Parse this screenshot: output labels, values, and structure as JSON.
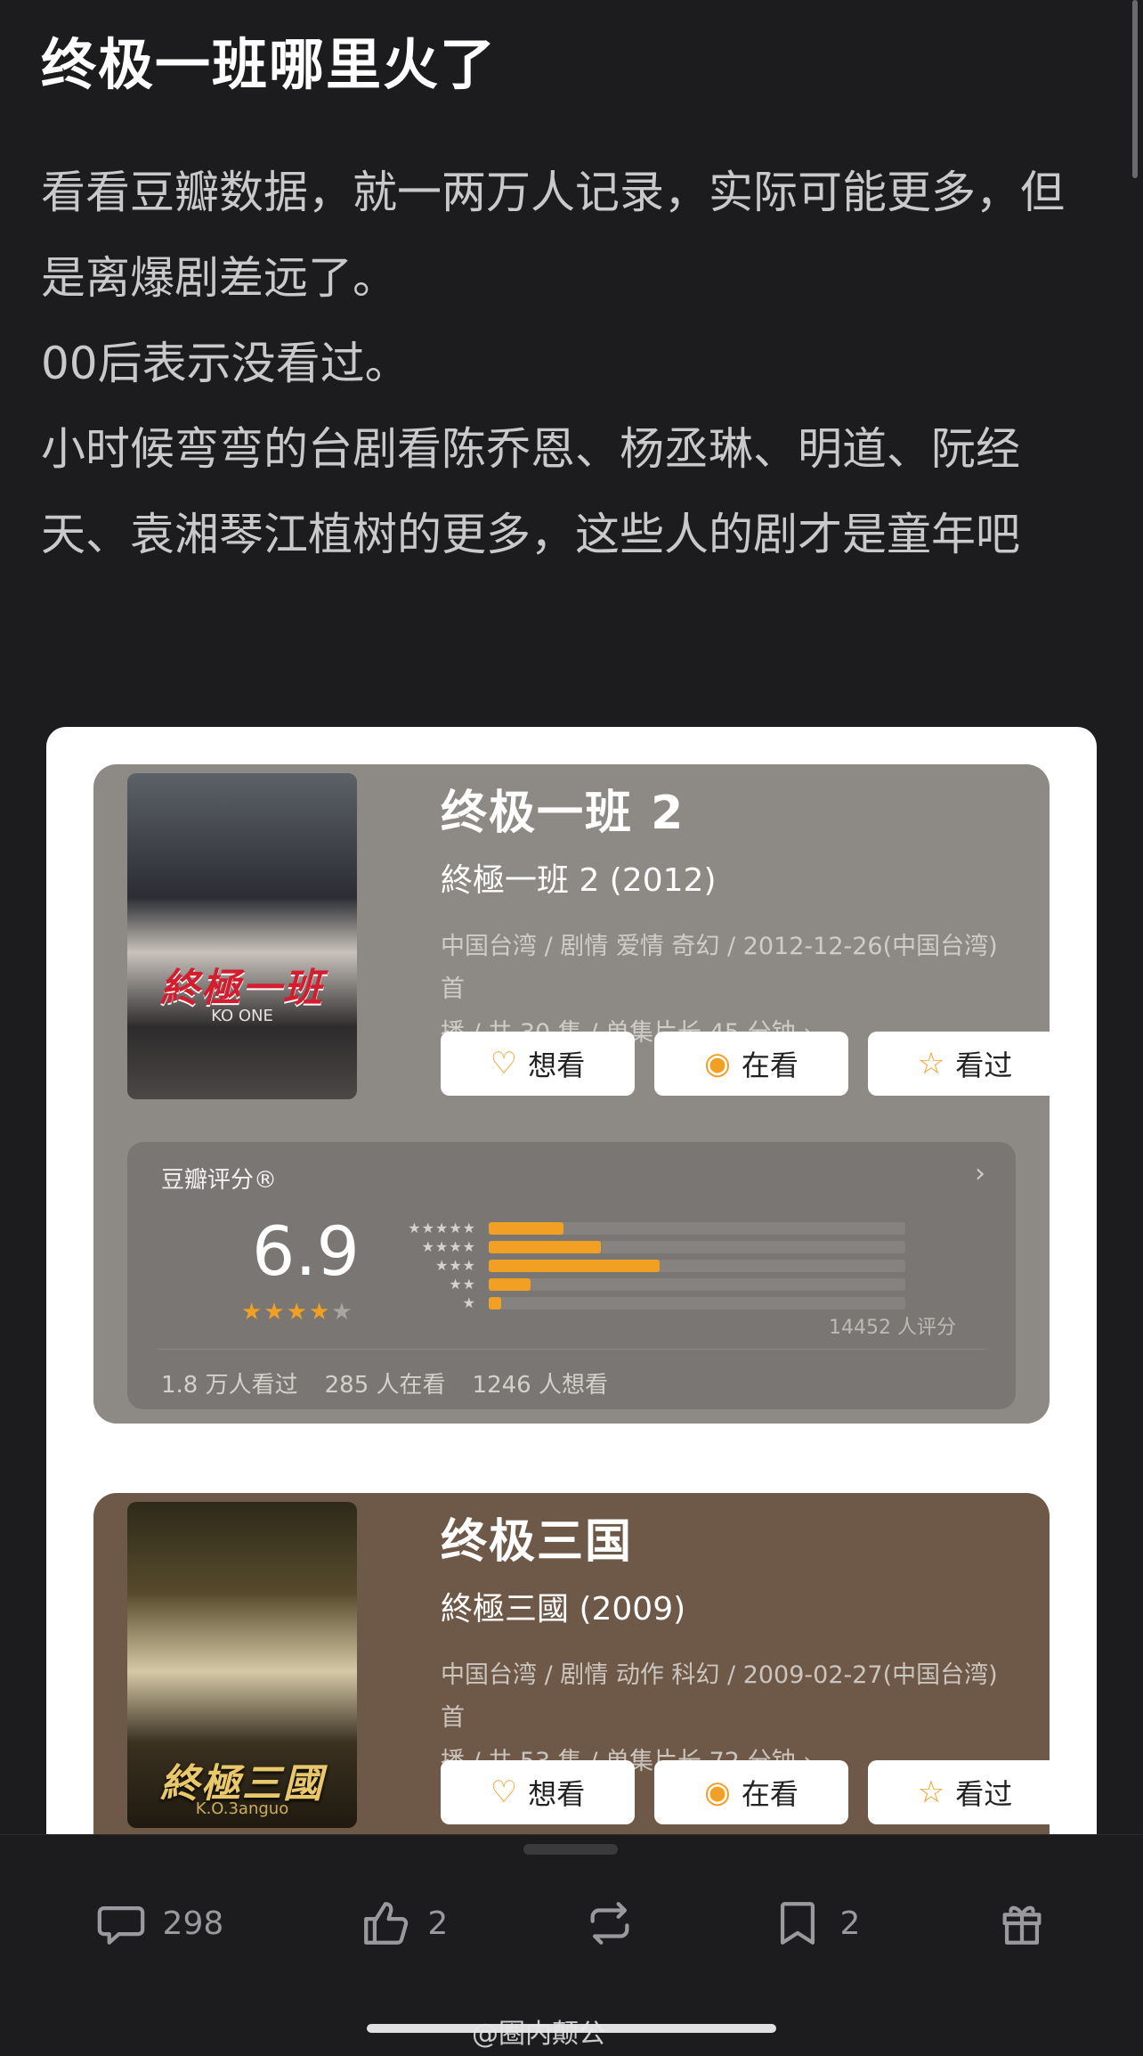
{
  "post": {
    "title": "终极一班哪里火了",
    "paragraphs": [
      "看看豆瓣数据，就一两万人记录，实际可能更多，但是离爆剧差远了。",
      "00后表示没看过。",
      "小时候弯弯的台剧看陈乔恩、杨丞琳、明道、阮经天、袁湘琴江植树的更多，这些人的剧才是童年吧"
    ]
  },
  "cards": [
    {
      "title": "终极一班 2",
      "original_title": "終極一班 2 (2012)",
      "meta_line1": "中国台湾 / 剧情 爱情 奇幻 / 2012-12-26(中国台湾) 首",
      "meta_line2": "播 / 共 30 集 / 单集片长 45 分钟",
      "poster_text": "終極一班",
      "poster_sub": "KO ONE",
      "buttons": {
        "want": "想看",
        "watching": "在看",
        "watched": "看过"
      },
      "rating": {
        "label": "豆瓣评分®",
        "score": "6.9",
        "stars": 3.5,
        "distribution": [
          0.18,
          0.27,
          0.41,
          0.1,
          0.03
        ],
        "count": "14452 人评分",
        "stats": [
          "1.8 万人看过",
          "285 人在看",
          "1246 人想看"
        ]
      }
    },
    {
      "title": "终极三国",
      "original_title": "終極三國 (2009)",
      "meta_line1": "中国台湾 / 剧情 动作 科幻 / 2009-02-27(中国台湾) 首",
      "meta_line2": "播 / 共 53 集 / 单集片长 72 分钟",
      "poster_text": "終極三國",
      "poster_sub": "K.O.3anguo",
      "buttons": {
        "want": "想看",
        "watching": "在看",
        "watched": "看过"
      }
    }
  ],
  "bottom_bar": {
    "comments": "298",
    "likes": "2",
    "repost": "",
    "favorites": "2"
  },
  "watermark": "@圈内颠公",
  "colors": {
    "accent": "#f2a024",
    "background": "#1c1c1e"
  }
}
